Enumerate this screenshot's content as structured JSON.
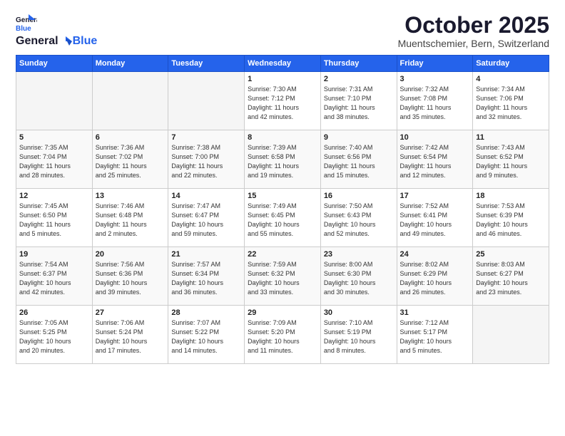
{
  "logo": {
    "general": "General",
    "blue": "Blue"
  },
  "header": {
    "title": "October 2025",
    "subtitle": "Muentschemier, Bern, Switzerland"
  },
  "weekdays": [
    "Sunday",
    "Monday",
    "Tuesday",
    "Wednesday",
    "Thursday",
    "Friday",
    "Saturday"
  ],
  "weeks": [
    [
      {
        "day": "",
        "info": ""
      },
      {
        "day": "",
        "info": ""
      },
      {
        "day": "",
        "info": ""
      },
      {
        "day": "1",
        "info": "Sunrise: 7:30 AM\nSunset: 7:12 PM\nDaylight: 11 hours\nand 42 minutes."
      },
      {
        "day": "2",
        "info": "Sunrise: 7:31 AM\nSunset: 7:10 PM\nDaylight: 11 hours\nand 38 minutes."
      },
      {
        "day": "3",
        "info": "Sunrise: 7:32 AM\nSunset: 7:08 PM\nDaylight: 11 hours\nand 35 minutes."
      },
      {
        "day": "4",
        "info": "Sunrise: 7:34 AM\nSunset: 7:06 PM\nDaylight: 11 hours\nand 32 minutes."
      }
    ],
    [
      {
        "day": "5",
        "info": "Sunrise: 7:35 AM\nSunset: 7:04 PM\nDaylight: 11 hours\nand 28 minutes."
      },
      {
        "day": "6",
        "info": "Sunrise: 7:36 AM\nSunset: 7:02 PM\nDaylight: 11 hours\nand 25 minutes."
      },
      {
        "day": "7",
        "info": "Sunrise: 7:38 AM\nSunset: 7:00 PM\nDaylight: 11 hours\nand 22 minutes."
      },
      {
        "day": "8",
        "info": "Sunrise: 7:39 AM\nSunset: 6:58 PM\nDaylight: 11 hours\nand 19 minutes."
      },
      {
        "day": "9",
        "info": "Sunrise: 7:40 AM\nSunset: 6:56 PM\nDaylight: 11 hours\nand 15 minutes."
      },
      {
        "day": "10",
        "info": "Sunrise: 7:42 AM\nSunset: 6:54 PM\nDaylight: 11 hours\nand 12 minutes."
      },
      {
        "day": "11",
        "info": "Sunrise: 7:43 AM\nSunset: 6:52 PM\nDaylight: 11 hours\nand 9 minutes."
      }
    ],
    [
      {
        "day": "12",
        "info": "Sunrise: 7:45 AM\nSunset: 6:50 PM\nDaylight: 11 hours\nand 5 minutes."
      },
      {
        "day": "13",
        "info": "Sunrise: 7:46 AM\nSunset: 6:48 PM\nDaylight: 11 hours\nand 2 minutes."
      },
      {
        "day": "14",
        "info": "Sunrise: 7:47 AM\nSunset: 6:47 PM\nDaylight: 10 hours\nand 59 minutes."
      },
      {
        "day": "15",
        "info": "Sunrise: 7:49 AM\nSunset: 6:45 PM\nDaylight: 10 hours\nand 55 minutes."
      },
      {
        "day": "16",
        "info": "Sunrise: 7:50 AM\nSunset: 6:43 PM\nDaylight: 10 hours\nand 52 minutes."
      },
      {
        "day": "17",
        "info": "Sunrise: 7:52 AM\nSunset: 6:41 PM\nDaylight: 10 hours\nand 49 minutes."
      },
      {
        "day": "18",
        "info": "Sunrise: 7:53 AM\nSunset: 6:39 PM\nDaylight: 10 hours\nand 46 minutes."
      }
    ],
    [
      {
        "day": "19",
        "info": "Sunrise: 7:54 AM\nSunset: 6:37 PM\nDaylight: 10 hours\nand 42 minutes."
      },
      {
        "day": "20",
        "info": "Sunrise: 7:56 AM\nSunset: 6:36 PM\nDaylight: 10 hours\nand 39 minutes."
      },
      {
        "day": "21",
        "info": "Sunrise: 7:57 AM\nSunset: 6:34 PM\nDaylight: 10 hours\nand 36 minutes."
      },
      {
        "day": "22",
        "info": "Sunrise: 7:59 AM\nSunset: 6:32 PM\nDaylight: 10 hours\nand 33 minutes."
      },
      {
        "day": "23",
        "info": "Sunrise: 8:00 AM\nSunset: 6:30 PM\nDaylight: 10 hours\nand 30 minutes."
      },
      {
        "day": "24",
        "info": "Sunrise: 8:02 AM\nSunset: 6:29 PM\nDaylight: 10 hours\nand 26 minutes."
      },
      {
        "day": "25",
        "info": "Sunrise: 8:03 AM\nSunset: 6:27 PM\nDaylight: 10 hours\nand 23 minutes."
      }
    ],
    [
      {
        "day": "26",
        "info": "Sunrise: 7:05 AM\nSunset: 5:25 PM\nDaylight: 10 hours\nand 20 minutes."
      },
      {
        "day": "27",
        "info": "Sunrise: 7:06 AM\nSunset: 5:24 PM\nDaylight: 10 hours\nand 17 minutes."
      },
      {
        "day": "28",
        "info": "Sunrise: 7:07 AM\nSunset: 5:22 PM\nDaylight: 10 hours\nand 14 minutes."
      },
      {
        "day": "29",
        "info": "Sunrise: 7:09 AM\nSunset: 5:20 PM\nDaylight: 10 hours\nand 11 minutes."
      },
      {
        "day": "30",
        "info": "Sunrise: 7:10 AM\nSunset: 5:19 PM\nDaylight: 10 hours\nand 8 minutes."
      },
      {
        "day": "31",
        "info": "Sunrise: 7:12 AM\nSunset: 5:17 PM\nDaylight: 10 hours\nand 5 minutes."
      },
      {
        "day": "",
        "info": ""
      }
    ]
  ]
}
